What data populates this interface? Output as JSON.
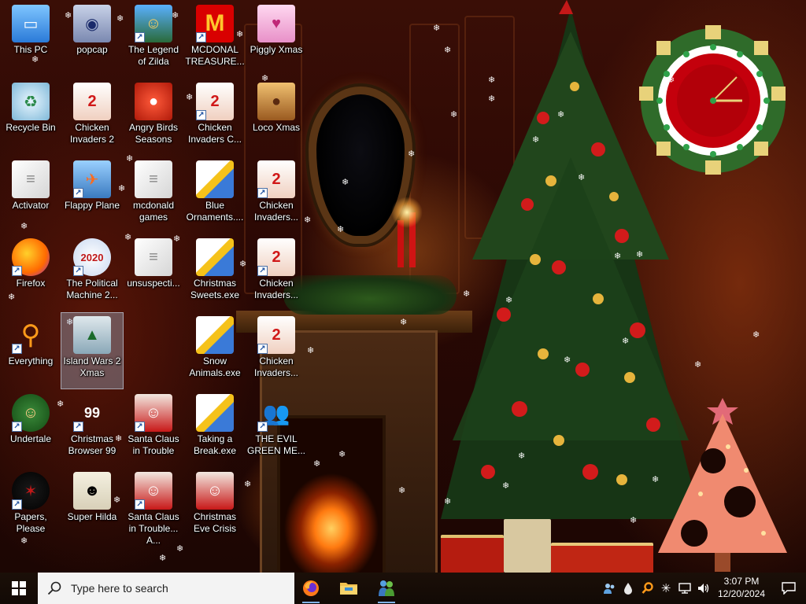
{
  "desktop": {
    "icons": [
      {
        "label": "This PC",
        "icon": "computer-icon",
        "shortcut": false
      },
      {
        "label": "Recycle Bin",
        "icon": "recycle-bin-icon",
        "shortcut": false
      },
      {
        "label": "Activator",
        "icon": "document-icon",
        "shortcut": false
      },
      {
        "label": "Firefox",
        "icon": "firefox-icon",
        "shortcut": true
      },
      {
        "label": "Everything",
        "icon": "magnifier-icon",
        "shortcut": true
      },
      {
        "label": "Undertale",
        "icon": "undertale-icon",
        "shortcut": true
      },
      {
        "label": "Papers, Please",
        "icon": "papers-please-icon",
        "shortcut": true
      },
      {
        "label": "popcap",
        "icon": "folder-icon",
        "shortcut": false
      },
      {
        "label": "Chicken Invaders 2",
        "icon": "chicken-icon",
        "shortcut": false
      },
      {
        "label": "Flappy Plane",
        "icon": "game-icon",
        "shortcut": true
      },
      {
        "label": "The Political Machine 2...",
        "icon": "political-machine-icon",
        "shortcut": true
      },
      {
        "label": "Island Wars 2 Xmas",
        "icon": "island-wars-icon",
        "shortcut": false
      },
      {
        "label": "Christmas Browser 99",
        "icon": "christmas-browser-icon",
        "shortcut": true
      },
      {
        "label": "Super Hilda",
        "icon": "pixel-character-icon",
        "shortcut": false
      },
      {
        "label": "The Legend of Zilda",
        "icon": "zilda-icon",
        "shortcut": true
      },
      {
        "label": "Angry Birds Seasons",
        "icon": "angry-birds-icon",
        "shortcut": false
      },
      {
        "label": "mcdonald games",
        "icon": "document-icon",
        "shortcut": false
      },
      {
        "label": "unsuspecti...",
        "icon": "document-icon",
        "shortcut": false
      },
      {
        "label": "Santa Claus in Trouble",
        "icon": "santa-icon",
        "shortcut": true
      },
      {
        "label": "Santa Claus in Trouble... A...",
        "icon": "santa-icon",
        "shortcut": true
      },
      {
        "label": "MCDONAL TREASURE...",
        "icon": "mcdonalds-icon",
        "shortcut": true
      },
      {
        "label": "Chicken Invaders C...",
        "icon": "chicken-icon",
        "shortcut": true
      },
      {
        "label": "Blue Ornaments....",
        "icon": "exe-icon",
        "shortcut": false
      },
      {
        "label": "Christmas Sweets.exe",
        "icon": "exe-icon",
        "shortcut": false
      },
      {
        "label": "Snow Animals.exe",
        "icon": "exe-icon",
        "shortcut": false
      },
      {
        "label": "Taking a Break.exe",
        "icon": "exe-icon",
        "shortcut": false
      },
      {
        "label": "Christmas Eve Crisis",
        "icon": "santa-icon",
        "shortcut": false
      },
      {
        "label": "Piggly Xmas",
        "icon": "pig-icon",
        "shortcut": false
      },
      {
        "label": "Loco Xmas",
        "icon": "bear-icon",
        "shortcut": false
      },
      {
        "label": "Chicken Invaders...",
        "icon": "chicken-icon",
        "shortcut": true
      },
      {
        "label": "Chicken Invaders...",
        "icon": "chicken-icon",
        "shortcut": true
      },
      {
        "label": "Chicken Invaders...",
        "icon": "chicken-icon",
        "shortcut": true
      },
      {
        "label": "THE EVIL GREEN ME...",
        "icon": "messenger-icon",
        "shortcut": true
      }
    ]
  },
  "taskbar": {
    "search_placeholder": "Type here to search",
    "apps": [
      "firefox-icon",
      "file-explorer-icon",
      "messenger-icon"
    ],
    "time": "3:07 PM",
    "date": "12/20/2024"
  },
  "colors": {
    "taskbar": "#120a05",
    "search_bg": "#f3f3f3",
    "clock_red": "#c4000c",
    "tree_pink": "#f08a70"
  }
}
